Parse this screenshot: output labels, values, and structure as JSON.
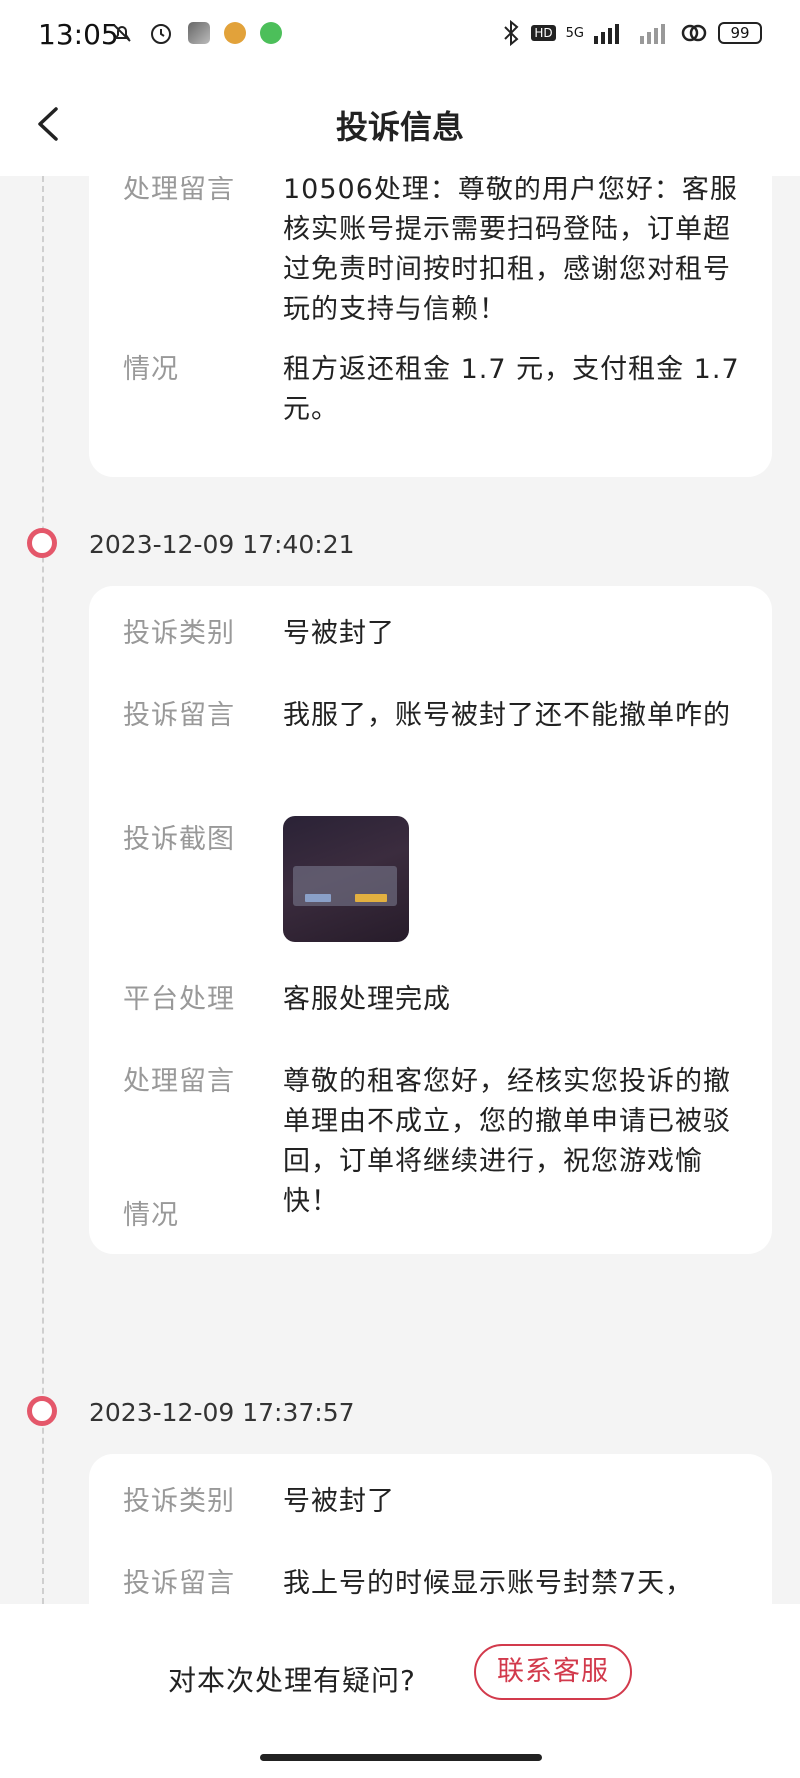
{
  "status_bar": {
    "time": "13:05",
    "battery": "99",
    "network": "5G"
  },
  "header": {
    "title": "投诉信息"
  },
  "records": [
    {
      "fields": [
        {
          "label": "处理留言",
          "value": "10506处理：尊敬的用户您好：客服核实账号提示需要扫码登陆，订单超过免责时间按时扣租，感谢您对租号玩的支持与信赖！"
        },
        {
          "label": "情况",
          "value": " 租方返还租金 1.7 元，支付租金 1.7 元。"
        }
      ]
    },
    {
      "timestamp": "2023-12-09 17:40:21",
      "fields": [
        {
          "label": "投诉类别",
          "value": "号被封了"
        },
        {
          "label": "投诉留言",
          "value": "我服了，账号被封了还不能撤单咋的"
        },
        {
          "label": "投诉截图",
          "value": ""
        },
        {
          "label": "平台处理",
          "value": "客服处理完成"
        },
        {
          "label": "处理留言",
          "value": "尊敬的租客您好，经核实您投诉的撤单理由不成立，您的撤单申请已被驳回，订单将继续进行，祝您游戏愉快！"
        },
        {
          "label": "情况",
          "value": ""
        }
      ]
    },
    {
      "timestamp": "2023-12-09 17:37:57",
      "fields": [
        {
          "label": "投诉类别",
          "value": "号被封了"
        },
        {
          "label": "投诉留言",
          "value": "我上号的时候显示账号封禁7天，"
        }
      ]
    }
  ],
  "bottom": {
    "question": "对本次处理有疑问?",
    "contact_button": "联系客服"
  },
  "colors": {
    "accent": "#d23a4c",
    "timeline_dot": "#e4576a",
    "background": "#f4f4f4",
    "label": "#999999"
  }
}
